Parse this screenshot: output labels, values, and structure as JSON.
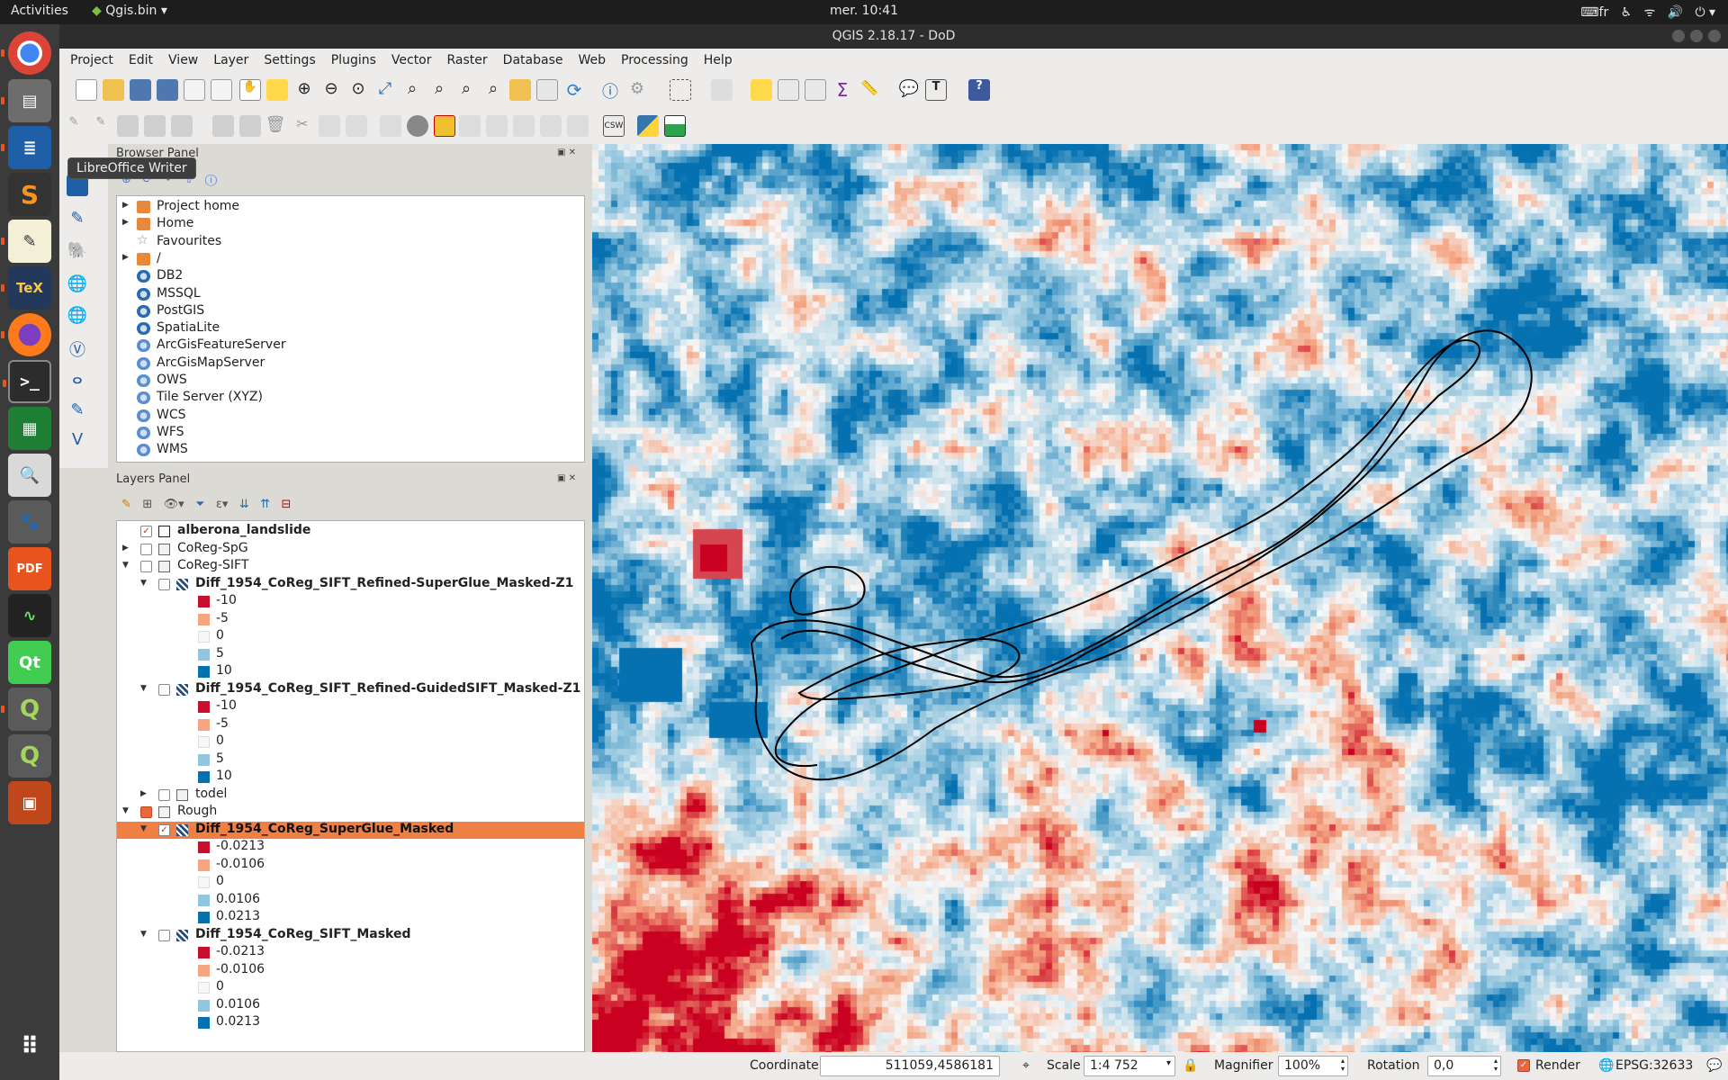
{
  "topbar": {
    "activities": "Activities",
    "app_name": "Qgis.bin ▾",
    "clock": "mer. 10:41",
    "keyboard": "fr"
  },
  "launcher": {
    "tooltip": "LibreOffice Writer"
  },
  "window": {
    "title": "QGIS 2.18.17 - DoD"
  },
  "menu": [
    "Project",
    "Edit",
    "View",
    "Layer",
    "Settings",
    "Plugins",
    "Vector",
    "Raster",
    "Database",
    "Web",
    "Processing",
    "Help"
  ],
  "browser_panel": {
    "title": "Browser Panel",
    "items": [
      {
        "label": "Project home",
        "icon": "folder-icon",
        "expandable": true
      },
      {
        "label": "Home",
        "icon": "folder-icon",
        "expandable": true
      },
      {
        "label": "Favourites",
        "icon": "star-icon",
        "expandable": false
      },
      {
        "label": "/",
        "icon": "folder-icon",
        "expandable": true
      },
      {
        "label": "DB2",
        "icon": "db2-icon",
        "expandable": false
      },
      {
        "label": "MSSQL",
        "icon": "mssql-icon",
        "expandable": false
      },
      {
        "label": "PostGIS",
        "icon": "postgis-icon",
        "expandable": false
      },
      {
        "label": "SpatiaLite",
        "icon": "spatialite-icon",
        "expandable": false
      },
      {
        "label": "ArcGisFeatureServer",
        "icon": "globe-icon",
        "expandable": false
      },
      {
        "label": "ArcGisMapServer",
        "icon": "globe-icon",
        "expandable": false
      },
      {
        "label": "OWS",
        "icon": "globe-icon",
        "expandable": false
      },
      {
        "label": "Tile Server (XYZ)",
        "icon": "globe-icon",
        "expandable": false
      },
      {
        "label": "WCS",
        "icon": "globe-icon",
        "expandable": false
      },
      {
        "label": "WFS",
        "icon": "globe-icon",
        "expandable": false
      },
      {
        "label": "WMS",
        "icon": "globe-icon",
        "expandable": false
      }
    ]
  },
  "layers_panel": {
    "title": "Layers Panel",
    "rows": [
      {
        "label": "alberona_landslide",
        "kind": "layer-vector",
        "bold": true,
        "checked": true,
        "indent": 0,
        "expander": ""
      },
      {
        "label": "CoReg-SpG",
        "kind": "group",
        "bold": false,
        "checked": false,
        "indent": 0,
        "expander": "▶"
      },
      {
        "label": "CoReg-SIFT",
        "kind": "group",
        "bold": false,
        "checked": false,
        "indent": 0,
        "expander": "▼"
      },
      {
        "label": "Diff_1954_CoReg_SIFT_Refined-SuperGlue_Masked-Z1",
        "kind": "layer-raster",
        "bold": true,
        "checked": false,
        "indent": 1,
        "expander": "▼"
      },
      {
        "label": "-10",
        "kind": "legend",
        "color": "#c8102e",
        "indent": 2
      },
      {
        "label": "-5",
        "kind": "legend",
        "color": "#f4a582",
        "indent": 2
      },
      {
        "label": "0",
        "kind": "legend",
        "color": "#f7f7f7",
        "indent": 2
      },
      {
        "label": "5",
        "kind": "legend",
        "color": "#92c5de",
        "indent": 2
      },
      {
        "label": "10",
        "kind": "legend",
        "color": "#0571b0",
        "indent": 2
      },
      {
        "label": "Diff_1954_CoReg_SIFT_Refined-GuidedSIFT_Masked-Z1",
        "kind": "layer-raster",
        "bold": true,
        "checked": false,
        "indent": 1,
        "expander": "▼"
      },
      {
        "label": "-10",
        "kind": "legend",
        "color": "#c8102e",
        "indent": 2
      },
      {
        "label": "-5",
        "kind": "legend",
        "color": "#f4a582",
        "indent": 2
      },
      {
        "label": "0",
        "kind": "legend",
        "color": "#f7f7f7",
        "indent": 2
      },
      {
        "label": "5",
        "kind": "legend",
        "color": "#92c5de",
        "indent": 2
      },
      {
        "label": "10",
        "kind": "legend",
        "color": "#0571b0",
        "indent": 2
      },
      {
        "label": "todel",
        "kind": "group",
        "bold": false,
        "checked": false,
        "indent": 1,
        "expander": "▶"
      },
      {
        "label": "Rough",
        "kind": "group-partial",
        "bold": false,
        "checked": true,
        "indent": 0,
        "expander": "▼"
      },
      {
        "label": "Diff_1954_CoReg_SuperGlue_Masked",
        "kind": "layer-raster",
        "bold": true,
        "checked": true,
        "indent": 1,
        "expander": "▼",
        "selected": true
      },
      {
        "label": "-0.0213",
        "kind": "legend",
        "color": "#c8102e",
        "indent": 2
      },
      {
        "label": "-0.0106",
        "kind": "legend",
        "color": "#f4a582",
        "indent": 2
      },
      {
        "label": "0",
        "kind": "legend",
        "color": "#f7f7f7",
        "indent": 2
      },
      {
        "label": "0.0106",
        "kind": "legend",
        "color": "#92c5de",
        "indent": 2
      },
      {
        "label": "0.0213",
        "kind": "legend",
        "color": "#0571b0",
        "indent": 2
      },
      {
        "label": "Diff_1954_CoReg_SIFT_Masked",
        "kind": "layer-raster",
        "bold": true,
        "checked": false,
        "indent": 1,
        "expander": "▼"
      },
      {
        "label": "-0.0213",
        "kind": "legend",
        "color": "#c8102e",
        "indent": 2
      },
      {
        "label": "-0.0106",
        "kind": "legend",
        "color": "#f4a582",
        "indent": 2
      },
      {
        "label": "0",
        "kind": "legend",
        "color": "#f7f7f7",
        "indent": 2
      },
      {
        "label": "0.0106",
        "kind": "legend",
        "color": "#92c5de",
        "indent": 2
      },
      {
        "label": "0.0213",
        "kind": "legend",
        "color": "#0571b0",
        "indent": 2
      }
    ]
  },
  "statusbar": {
    "coordinate_label": "Coordinate",
    "coordinate_value": "511059,4586181",
    "scale_label": "Scale",
    "scale_value": "1:4 752",
    "magnifier_label": "Magnifier",
    "magnifier_value": "100%",
    "rotation_label": "Rotation",
    "rotation_value": "0,0",
    "render_label": "Render",
    "epsg_label": "EPSG:32633"
  },
  "colors": {
    "selection": "#ef8045",
    "accent_ubuntu": "#e95420"
  }
}
